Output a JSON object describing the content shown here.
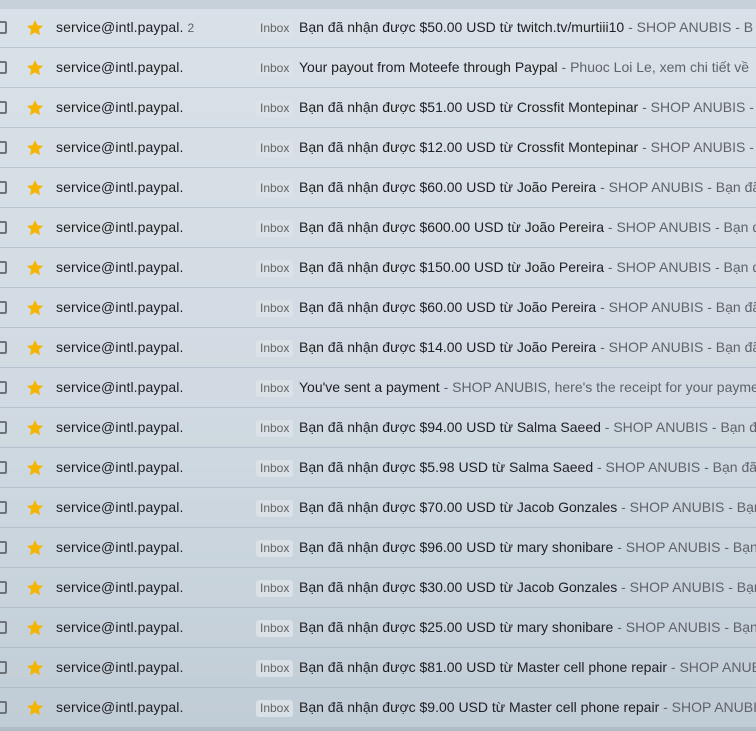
{
  "colors": {
    "star": "#f4b400",
    "sender_text": "#202124",
    "muted_text": "#5f6368"
  },
  "emails": [
    {
      "sender": "service@intl.paypal.",
      "count": "2",
      "label": "Inbox",
      "subject": "Bạn đã nhận được $50.00 USD từ twitch.tv/murtiii10",
      "snippet": " - SHOP ANUBIS - B"
    },
    {
      "sender": "service@intl.paypal.",
      "count": "",
      "label": "Inbox",
      "subject": "Your payout from Moteefe through Paypal",
      "snippet": " - Phuoc Loi Le, xem chi tiết về"
    },
    {
      "sender": "service@intl.paypal.",
      "count": "",
      "label": "Inbox",
      "subject": "Bạn đã nhận được $51.00 USD từ Crossfit Montepinar",
      "snippet": " - SHOP ANUBIS -"
    },
    {
      "sender": "service@intl.paypal.",
      "count": "",
      "label": "Inbox",
      "subject": "Bạn đã nhận được $12.00 USD từ Crossfit Montepinar",
      "snippet": " - SHOP ANUBIS -"
    },
    {
      "sender": "service@intl.paypal.",
      "count": "",
      "label": "Inbox",
      "subject": "Bạn đã nhận được $60.00 USD từ João Pereira",
      "snippet": " - SHOP ANUBIS - Bạn đã"
    },
    {
      "sender": "service@intl.paypal.",
      "count": "",
      "label": "Inbox",
      "subject": "Bạn đã nhận được $600.00 USD từ João Pereira",
      "snippet": " - SHOP ANUBIS - Bạn đ"
    },
    {
      "sender": "service@intl.paypal.",
      "count": "",
      "label": "Inbox",
      "subject": "Bạn đã nhận được $150.00 USD từ João Pereira",
      "snippet": " - SHOP ANUBIS - Bạn đã"
    },
    {
      "sender": "service@intl.paypal.",
      "count": "",
      "label": "Inbox",
      "subject": "Bạn đã nhận được $60.00 USD từ João Pereira",
      "snippet": " - SHOP ANUBIS - Bạn đã"
    },
    {
      "sender": "service@intl.paypal.",
      "count": "",
      "label": "Inbox",
      "subject": "Bạn đã nhận được $14.00 USD từ João Pereira",
      "snippet": " - SHOP ANUBIS - Bạn đã"
    },
    {
      "sender": "service@intl.paypal.",
      "count": "",
      "label": "Inbox",
      "subject": "You've sent a payment",
      "snippet": " - SHOP ANUBIS, here's the receipt for your payme"
    },
    {
      "sender": "service@intl.paypal.",
      "count": "",
      "label": "Inbox",
      "subject": "Bạn đã nhận được $94.00 USD từ Salma Saeed",
      "snippet": " - SHOP ANUBIS - Bạn đã"
    },
    {
      "sender": "service@intl.paypal.",
      "count": "",
      "label": "Inbox",
      "subject": "Bạn đã nhận được $5.98 USD từ Salma Saeed",
      "snippet": " - SHOP ANUBIS - Bạn đã n"
    },
    {
      "sender": "service@intl.paypal.",
      "count": "",
      "label": "Inbox",
      "subject": "Bạn đã nhận được $70.00 USD từ Jacob Gonzales",
      "snippet": " - SHOP ANUBIS - Bạn"
    },
    {
      "sender": "service@intl.paypal.",
      "count": "",
      "label": "Inbox",
      "subject": "Bạn đã nhận được $96.00 USD từ mary shonibare",
      "snippet": " - SHOP ANUBIS - Bạn"
    },
    {
      "sender": "service@intl.paypal.",
      "count": "",
      "label": "Inbox",
      "subject": "Bạn đã nhận được $30.00 USD từ Jacob Gonzales",
      "snippet": " - SHOP ANUBIS - Bạn"
    },
    {
      "sender": "service@intl.paypal.",
      "count": "",
      "label": "Inbox",
      "subject": "Bạn đã nhận được $25.00 USD từ mary shonibare",
      "snippet": " - SHOP ANUBIS - Bạn"
    },
    {
      "sender": "service@intl.paypal.",
      "count": "",
      "label": "Inbox",
      "subject": "Bạn đã nhận được $81.00 USD từ Master cell phone repair",
      "snippet": " - SHOP ANUBI"
    },
    {
      "sender": "service@intl.paypal.",
      "count": "",
      "label": "Inbox",
      "subject": "Bạn đã nhận được $9.00 USD từ Master cell phone repair",
      "snippet": " - SHOP ANUBI"
    }
  ]
}
